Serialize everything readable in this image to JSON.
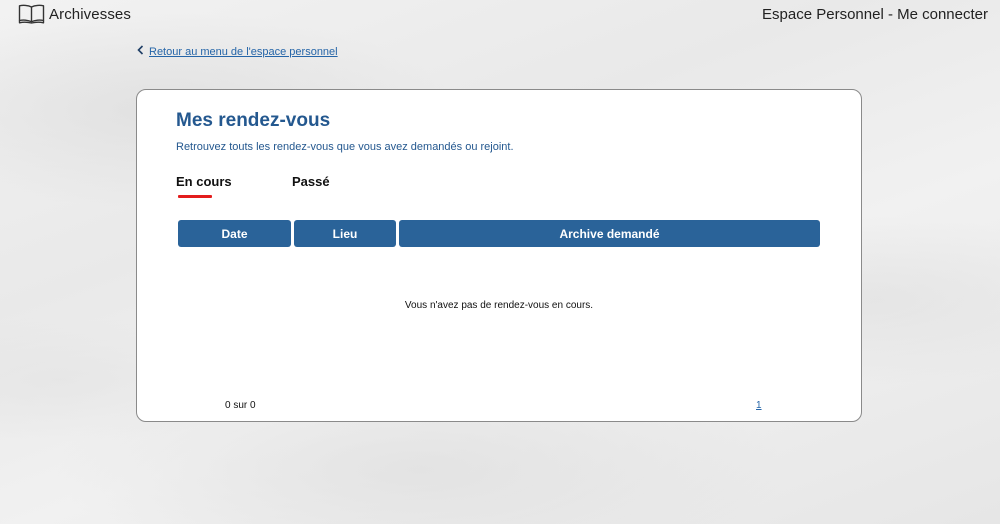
{
  "header": {
    "brand": "Archivesses",
    "logo_icon": "open-book-icon",
    "user_link": "Espace Personnel - Me connecter"
  },
  "back_link": {
    "icon": "chevron-left-icon",
    "label": "Retour au menu de l'espace personnel"
  },
  "card": {
    "title": "Mes rendez-vous",
    "subtitle": "Retrouvez touts les rendez-vous que vous avez demandés ou rejoint.",
    "tabs": [
      {
        "label": "En cours",
        "active": true
      },
      {
        "label": "Passé",
        "active": false
      }
    ],
    "table": {
      "columns": [
        "Date",
        "Lieu",
        "Archive demandé"
      ],
      "rows": []
    },
    "empty_message": "Vous n'avez pas de rendez-vous en cours.",
    "pagination": {
      "count_text": "0 sur 0",
      "pages": [
        "1"
      ]
    }
  },
  "colors": {
    "accent": "#2a6399",
    "title": "#24588f",
    "tab_indicator": "#e31d1d",
    "link": "#2565a8"
  }
}
